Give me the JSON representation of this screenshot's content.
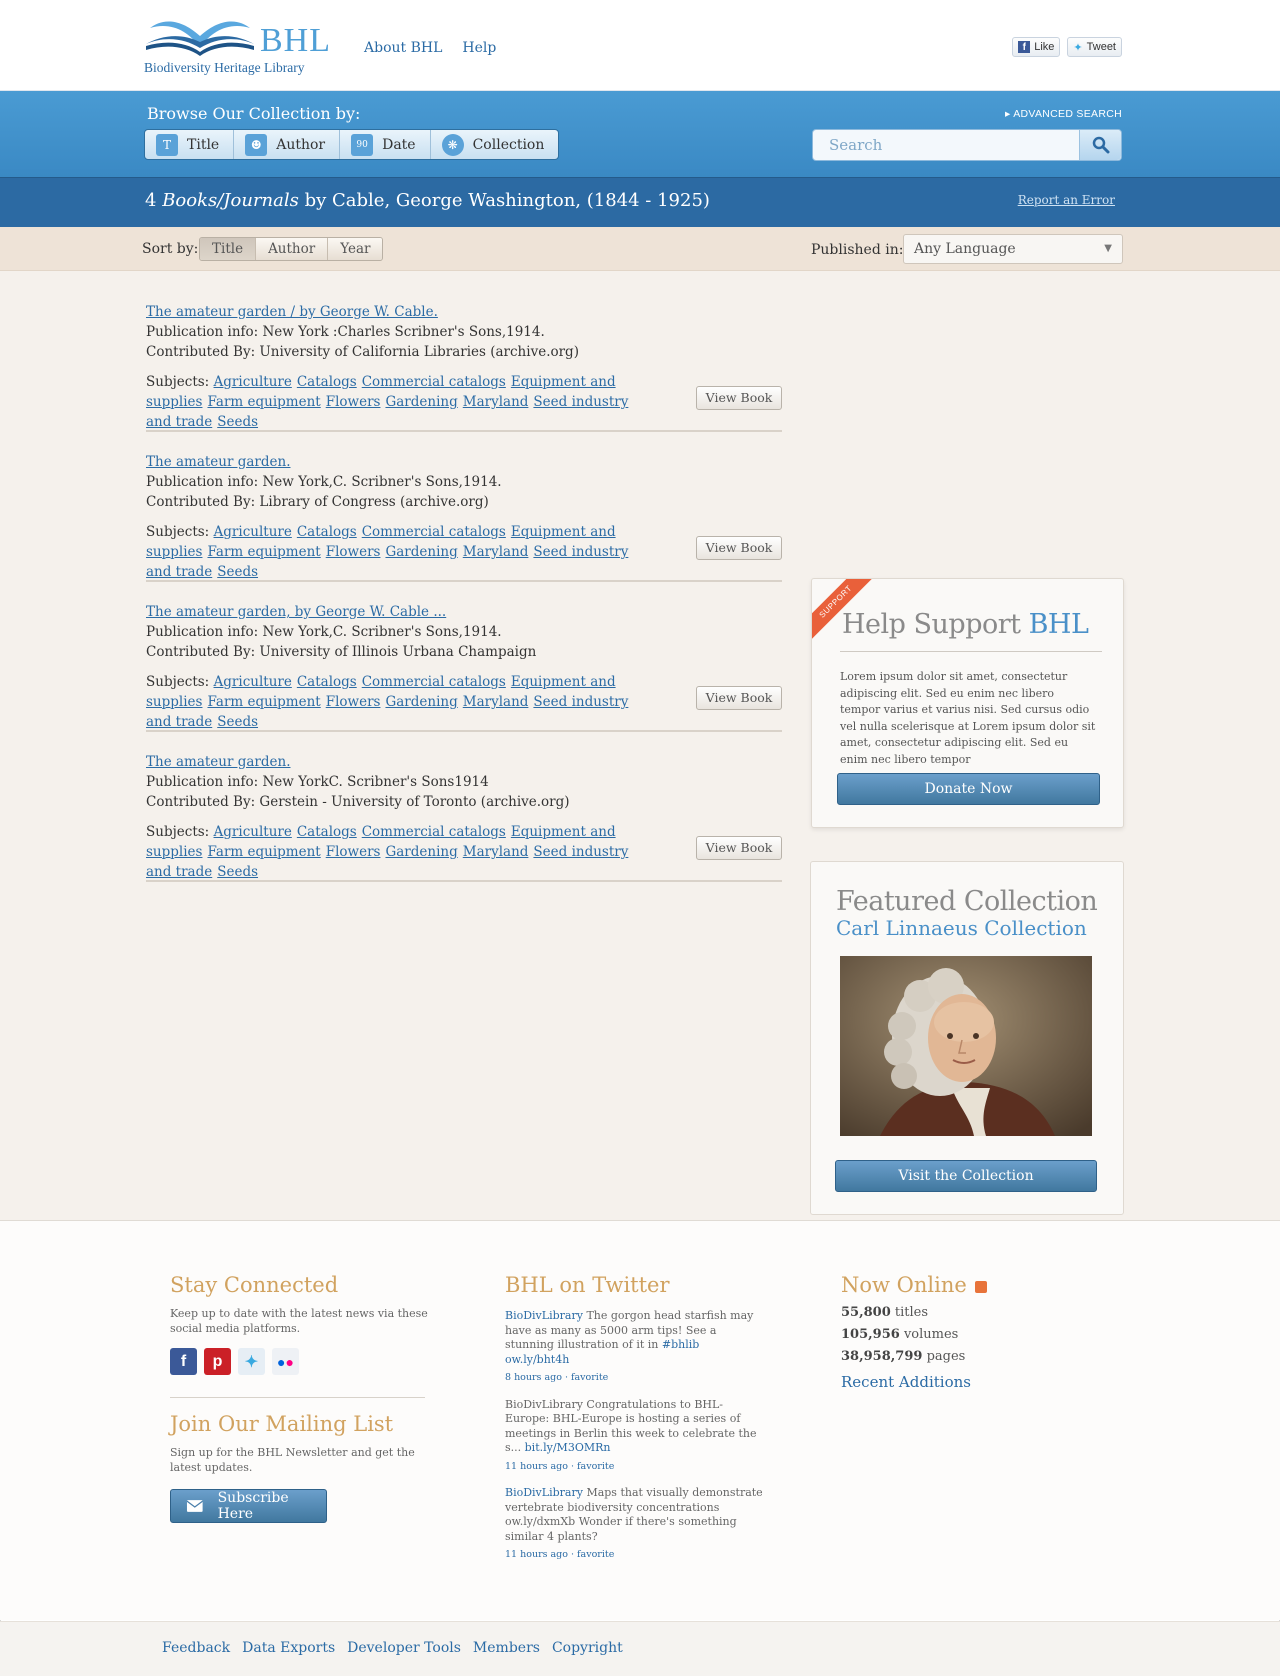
{
  "header": {
    "logo_text": "BHL",
    "logo_subtitle": "Biodiversity Heritage Library",
    "nav": [
      "About BHL",
      "Help"
    ],
    "like_label": "Like",
    "tweet_label": "Tweet"
  },
  "browse": {
    "label": "Browse Our Collection by:",
    "tabs": [
      {
        "label": "Title",
        "icon": "T"
      },
      {
        "label": "Author",
        "icon": "author-icon"
      },
      {
        "label": "Date",
        "icon": "90"
      },
      {
        "label": "Collection",
        "icon": "collection-icon"
      }
    ],
    "advanced_search": "ADVANCED SEARCH",
    "search_placeholder": "Search"
  },
  "results": {
    "count": "4",
    "kind": "Books/Journals",
    "suffix": "by Cable, George Washington, (1844 - 1925)",
    "report_error": "Report an Error"
  },
  "sort": {
    "label": "Sort by:",
    "options": [
      "Title",
      "Author",
      "Year"
    ],
    "active": "Title",
    "published_label": "Published in:",
    "language": "Any Language"
  },
  "items": [
    {
      "title": "The amateur garden / by George W. Cable.",
      "publication": "Publication info: New York :Charles Scribner's Sons,1914.",
      "contributed": "Contributed By: University of California Libraries (archive.org)"
    },
    {
      "title": "The amateur garden.",
      "publication": "Publication info: New York,C. Scribner's Sons,1914.",
      "contributed": "Contributed By: Library of Congress (archive.org)"
    },
    {
      "title": "The amateur garden, by George W. Cable ...",
      "publication": "Publication info: New York,C. Scribner's Sons,1914.",
      "contributed": "Contributed By: University of Illinois Urbana Champaign"
    },
    {
      "title": "The amateur garden.",
      "publication": "Publication info: New YorkC. Scribner's Sons1914",
      "contributed": "Contributed By: Gerstein - University of Toronto (archive.org)"
    }
  ],
  "subjects_label": "Subjects:",
  "subjects": [
    "Agriculture",
    "Catalogs",
    "Commercial catalogs",
    "Equipment and supplies",
    "Farm equipment",
    "Flowers",
    "Gardening",
    "Maryland",
    "Seed industry and trade",
    "Seeds"
  ],
  "view_book_label": "View Book",
  "support": {
    "ribbon": "SUPPORT",
    "title_prefix": "Help Support",
    "title_brand": "BHL",
    "body": "Lorem ipsum dolor sit amet, consectetur adipiscing elit. Sed eu enim nec libero tempor varius et varius nisi. Sed cursus odio vel nulla scelerisque at Lorem ipsum dolor sit amet, consectetur adipiscing elit. Sed eu enim nec libero tempor",
    "button": "Donate Now"
  },
  "featured": {
    "title": "Featured Collection",
    "name": "Carl Linnaeus Collection",
    "button": "Visit the Collection"
  },
  "footer": {
    "stay_title": "Stay Connected",
    "stay_text": "Keep up to date with the latest news via these social media platforms.",
    "join_title": "Join Our Mailing List",
    "join_text": "Sign up for the BHL Newsletter and get the latest updates.",
    "subscribe": "Subscribe Here",
    "twitter_title": "BHL on Twitter",
    "tweets": [
      {
        "user": "BioDivLibrary",
        "text": "The gorgon head starfish may have as many as 5000 arm tips! See a stunning illustration of it in ",
        "tag": "#bhlib",
        "link": "ow.ly/bht4h",
        "meta": "8 hours ago · favorite"
      },
      {
        "user": "",
        "text": "BioDivLibrary Congratulations to BHL-Europe: BHL-Europe is hosting a series of meetings in Berlin this week to celebrate the s... ",
        "tag": "",
        "link": "bit.ly/M3OMRn",
        "meta": "11 hours ago · favorite"
      },
      {
        "user": "BioDivLibrary",
        "text": "Maps that visually demonstrate vertebrate biodiversity concentrations ow.ly/dxmXb Wonder if there's something similar 4 plants?",
        "tag": "",
        "link": "",
        "meta": "11 hours ago · favorite"
      }
    ],
    "online_title": "Now Online",
    "stats": [
      {
        "num": "55,800",
        "unit": "titles"
      },
      {
        "num": "105,956",
        "unit": "volumes"
      },
      {
        "num": "38,958,799",
        "unit": "pages"
      }
    ],
    "recent": "Recent Additions",
    "bottom_links": [
      "Feedback",
      "Data Exports",
      "Developer Tools",
      "Members",
      "Copyright"
    ]
  }
}
